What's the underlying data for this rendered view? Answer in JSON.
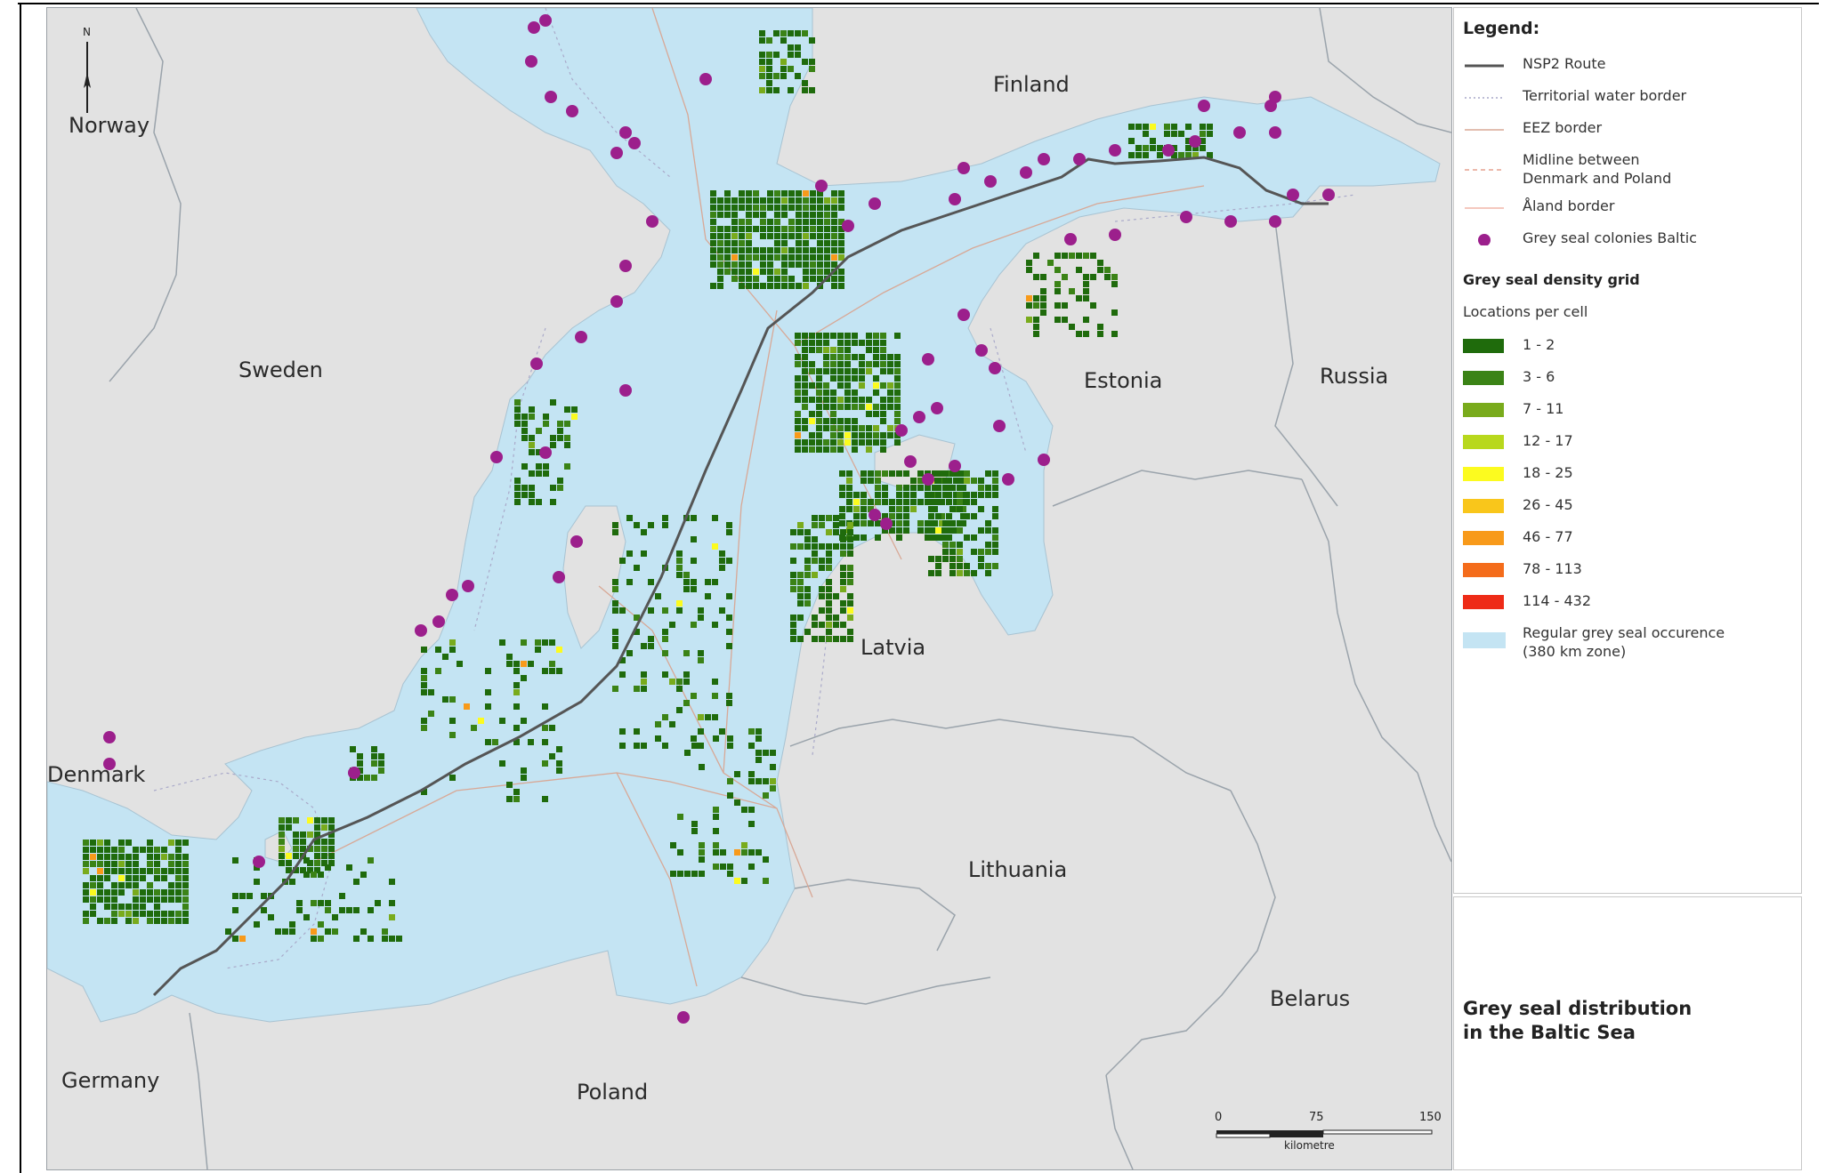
{
  "map": {
    "country_labels": {
      "norway": "Norway",
      "finland": "Finland",
      "sweden": "Sweden",
      "estonia": "Estonia",
      "russia": "Russia",
      "latvia": "Latvia",
      "denmark": "Denmark",
      "lithuania": "Lithuania",
      "belarus": "Belarus",
      "germany": "Germany",
      "poland": "Poland"
    },
    "north_arrow": "N",
    "scale": {
      "ticks": [
        "0",
        "75",
        "150"
      ],
      "unit": "kilometre"
    },
    "colors": {
      "land": "#e2e2e2",
      "sea": "#c4e4f3",
      "route": "#555555",
      "colony": "#9c1f8c",
      "border": "#9aa3ab"
    }
  },
  "legend": {
    "title": "Legend:",
    "lines": [
      {
        "label": "NSP2 Route",
        "color": "#555555",
        "style": "solid"
      },
      {
        "label": "Territorial water border",
        "color": "#a9a9c9",
        "style": "dotted"
      },
      {
        "label": "EEZ border",
        "color": "#d8a896",
        "style": "solid"
      },
      {
        "label": "Midline between\nDenmark and Poland",
        "color": "#e6a08f",
        "style": "dashed"
      },
      {
        "label": "Åland border",
        "color": "#f1b5a8",
        "style": "solid"
      },
      {
        "label": "Grey seal colonies Baltic",
        "color": "#9c1f8c",
        "style": "dot"
      }
    ],
    "grid_heading": "Grey seal density grid",
    "grid_subheading": "Locations per cell",
    "classes": [
      {
        "label": "1 - 2",
        "color": "#1f6b0c"
      },
      {
        "label": "3 - 6",
        "color": "#3b8316"
      },
      {
        "label": "7 - 11",
        "color": "#79ab1c"
      },
      {
        "label": "12 - 17",
        "color": "#b8d81d"
      },
      {
        "label": "18 - 25",
        "color": "#fcfb1f"
      },
      {
        "label": "26 - 45",
        "color": "#f9c61b"
      },
      {
        "label": "46 - 77",
        "color": "#f89a1a"
      },
      {
        "label": "78 - 113",
        "color": "#f46c1b"
      },
      {
        "label": "114 - 432",
        "color": "#ee2b17"
      }
    ],
    "zone": {
      "label": "Regular grey seal occurence\n(380 km zone)",
      "color": "#c4e4f3"
    }
  },
  "title_box": {
    "title": "Grey seal distribution\nin the Baltic Sea"
  }
}
